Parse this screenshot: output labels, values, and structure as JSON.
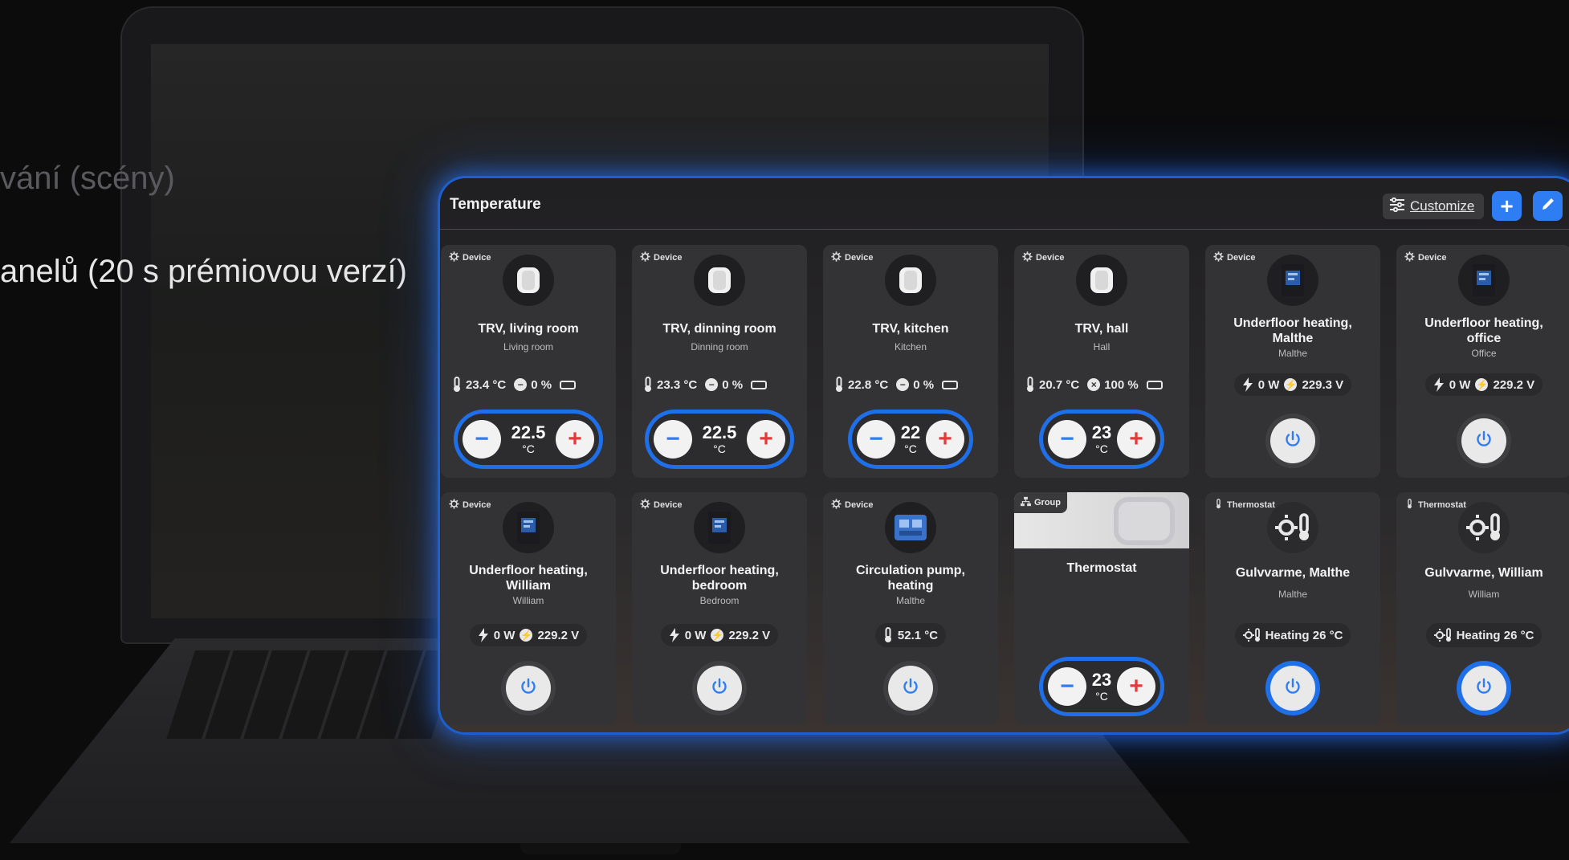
{
  "background": {
    "slide_text_1": "vání (scény)",
    "slide_text_2": "anelů (20 s prémiovou verzí)"
  },
  "header": {
    "title": "Temperature",
    "customize_label": "Customize",
    "add_label": "+",
    "accent_color": "#2f7df3"
  },
  "cards": [
    {
      "badge": "Device",
      "name": "TRV, living room",
      "room": "Living room",
      "stats": [
        "23.4 °C",
        "0 %"
      ],
      "setpoint": {
        "minus": "−",
        "value": "22.5",
        "unit": "°C",
        "plus": "+"
      }
    },
    {
      "badge": "Device",
      "name": "TRV, dinning room",
      "room": "Dinning room",
      "stats": [
        "23.3 °C",
        "0 %"
      ],
      "setpoint": {
        "minus": "−",
        "value": "22.5",
        "unit": "°C",
        "plus": "+"
      }
    },
    {
      "badge": "Device",
      "name": "TRV, kitchen",
      "room": "Kitchen",
      "stats": [
        "22.8 °C",
        "0 %"
      ],
      "setpoint": {
        "minus": "−",
        "value": "22",
        "unit": "°C",
        "plus": "+"
      }
    },
    {
      "badge": "Device",
      "name": "TRV, hall",
      "room": "Hall",
      "stats": [
        "20.7 °C",
        "100 %"
      ],
      "setpoint": {
        "minus": "−",
        "value": "23",
        "unit": "°C",
        "plus": "+"
      }
    },
    {
      "badge": "Device",
      "name_line1": "Underfloor heating,",
      "name_line2": "Malthe",
      "room": "Malthe",
      "stats": [
        "0 W",
        "229.3 V"
      ]
    },
    {
      "badge": "Device",
      "name_line1": "Underfloor heating,",
      "name_line2": "office",
      "room": "Office",
      "stats": [
        "0 W",
        "229.2 V"
      ]
    },
    {
      "badge": "Device",
      "name_line1": "Underfloor heating,",
      "name_line2": "William",
      "room": "William",
      "stats": [
        "0 W",
        "229.2 V"
      ]
    },
    {
      "badge": "Device",
      "name_line1": "Underfloor heating,",
      "name_line2": "bedroom",
      "room": "Bedroom",
      "stats": [
        "0 W",
        "229.2 V"
      ]
    },
    {
      "badge": "Device",
      "name_line1": "Circulation pump,",
      "name_line2": "heating",
      "room": "Malthe",
      "stats": [
        "52.1 °C"
      ]
    },
    {
      "badge": "Group",
      "name": "Thermostat",
      "setpoint": {
        "minus": "−",
        "value": "23",
        "unit": "°C",
        "plus": "+"
      }
    },
    {
      "badge": "Thermostat",
      "name": "Gulvvarme, Malthe",
      "room": "Malthe",
      "stats": [
        "Heating 26 °C"
      ]
    },
    {
      "badge": "Thermostat",
      "name": "Gulvvarme, William",
      "room": "William",
      "stats": [
        "Heating 26 °C"
      ]
    }
  ]
}
